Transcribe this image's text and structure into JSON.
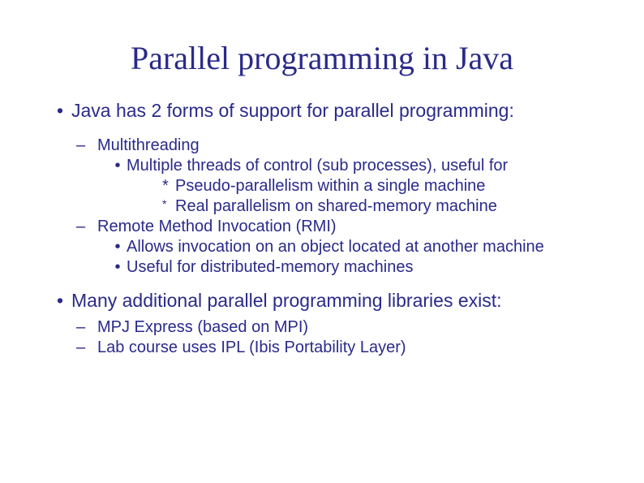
{
  "title": "Parallel programming in Java",
  "items": {
    "p1": "Java has 2 forms of support for parallel programming:",
    "p1a": "Multithreading",
    "p1a1": "Multiple threads of control (sub processes), useful for",
    "p1a1x": "Pseudo-parallelism within a single machine",
    "p1a1y": "Real parallelism on shared-memory machine",
    "p1b": "Remote Method Invocation (RMI)",
    "p1b1": "Allows invocation on an object located at another machine",
    "p1b2": "Useful for distributed-memory machines",
    "p2": "Many additional parallel programming libraries exist:",
    "p2a": "MPJ Express (based on MPI)",
    "p2b": "Lab course uses IPL (Ibis Portability Layer)"
  }
}
